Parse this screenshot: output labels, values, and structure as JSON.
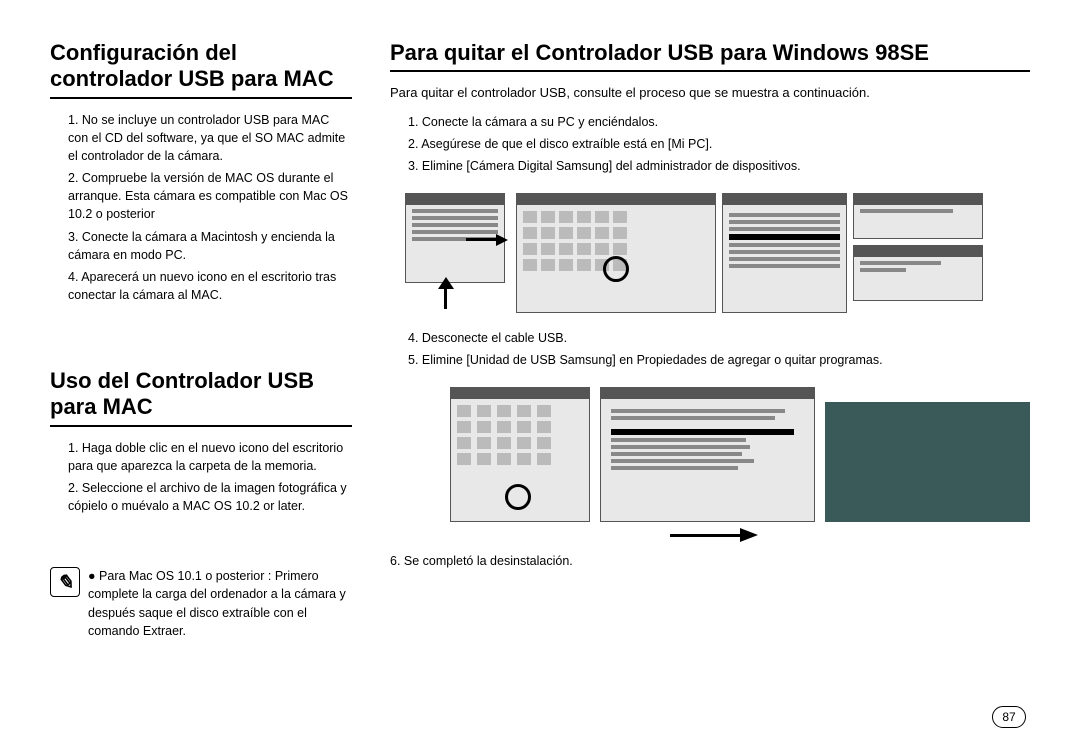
{
  "left": {
    "heading1": "Configuración del controlador USB para MAC",
    "list1": [
      "1. No se incluye un controlador USB para MAC con el CD del software, ya que el SO MAC admite el controlador de la cámara.",
      "2. Compruebe la versión de MAC OS durante el arranque. Esta cámara es compatible con Mac OS 10.2 o posterior",
      "3. Conecte la cámara a Macintosh y encienda la cámara en modo PC.",
      "4. Aparecerá un nuevo icono en el escritorio tras conectar la cámara al MAC."
    ],
    "heading2": "Uso del Controlador USB para MAC",
    "list2": [
      "1. Haga doble clic en el nuevo icono del escritorio para que aparezca la carpeta de la memoria.",
      "2. Seleccione el archivo de la imagen fotográfica y cópielo o muévalo a MAC OS 10.2 or later."
    ],
    "note_bullet": "●",
    "note": "Para Mac OS 10.1 o posterior : Primero complete la carga del ordenador a la cámara y después saque el disco extraíble con el comando Extraer."
  },
  "right": {
    "heading": "Para quitar el Controlador USB para Windows 98SE",
    "intro": "Para quitar el controlador USB, consulte el proceso que se muestra a continuación.",
    "list1": [
      "1. Conecte la cámara a su PC y enciéndalos.",
      "2. Asegúrese de que el disco extraíble está en [Mi PC].",
      "3. Elimine [Cámera Digital Samsung] del administrador de dispositivos."
    ],
    "list2": [
      "4. Desconecte el cable USB.",
      "5. Elimine [Unidad de USB Samsung] en Propiedades de agregar o quitar programas."
    ],
    "final": "6. Se completó la desinstalación."
  },
  "page_number": "87"
}
